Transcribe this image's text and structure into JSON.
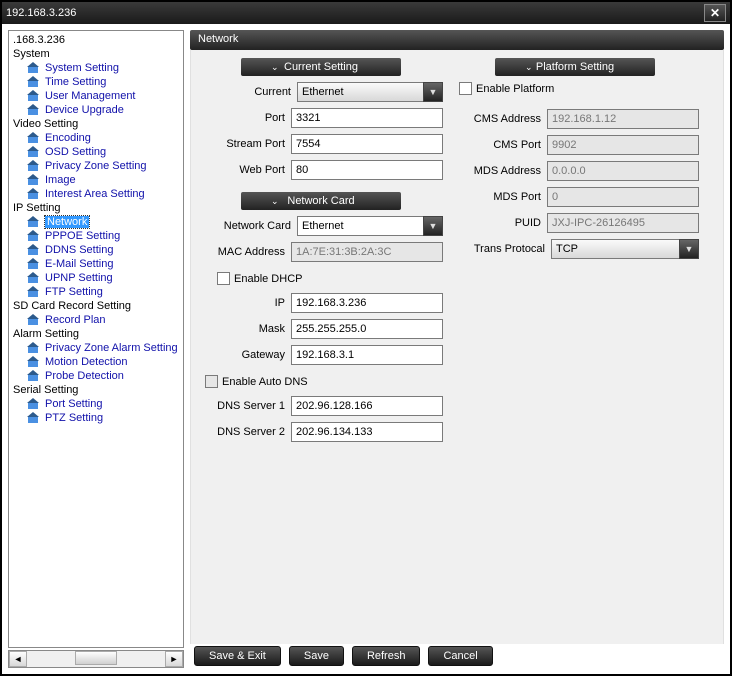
{
  "window": {
    "title": "192.168.3.236"
  },
  "sidebar": {
    "root": ".168.3.236",
    "groups": [
      {
        "label": "System",
        "items": [
          "System Setting",
          "Time Setting",
          "User Management",
          "Device Upgrade"
        ]
      },
      {
        "label": "Video Setting",
        "items": [
          "Encoding",
          "OSD Setting",
          "Privacy Zone Setting",
          "Image",
          "Interest Area Setting"
        ]
      },
      {
        "label": "IP Setting",
        "items": [
          "Network",
          "PPPOE Setting",
          "DDNS Setting",
          "E-Mail Setting",
          "UPNP Setting",
          "FTP Setting"
        ]
      },
      {
        "label": "SD Card Record Setting",
        "items": [
          "Record Plan"
        ]
      },
      {
        "label": "Alarm Setting",
        "items": [
          "Privacy Zone Alarm Setting",
          "Motion Detection",
          "Probe Detection"
        ]
      },
      {
        "label": "Serial Setting",
        "items": [
          "Port Setting",
          "PTZ Setting"
        ]
      }
    ],
    "selected": "Network"
  },
  "main": {
    "title": "Network",
    "sections": {
      "current": {
        "header": "Current Setting",
        "current_label": "Current",
        "current_value": "Ethernet",
        "port_label": "Port",
        "port_value": "3321",
        "stream_port_label": "Stream Port",
        "stream_port_value": "7554",
        "web_port_label": "Web Port",
        "web_port_value": "80"
      },
      "card": {
        "header": "Network Card",
        "card_label": "Network Card",
        "card_value": "Ethernet",
        "mac_label": "MAC Address",
        "mac_value": "1A:7E:31:3B:2A:3C",
        "dhcp_label": "Enable DHCP",
        "ip_label": "IP",
        "ip_value": "192.168.3.236",
        "mask_label": "Mask",
        "mask_value": "255.255.255.0",
        "gateway_label": "Gateway",
        "gateway_value": "192.168.3.1",
        "autodns_label": "Enable Auto DNS",
        "dns1_label": "DNS Server 1",
        "dns1_value": "202.96.128.166",
        "dns2_label": "DNS Server 2",
        "dns2_value": "202.96.134.133"
      },
      "platform": {
        "header": "Platform Setting",
        "enable_label": "Enable Platform",
        "cms_addr_label": "CMS Address",
        "cms_addr_value": "192.168.1.12",
        "cms_port_label": "CMS Port",
        "cms_port_value": "9902",
        "mds_addr_label": "MDS Address",
        "mds_addr_value": "0.0.0.0",
        "mds_port_label": "MDS Port",
        "mds_port_value": "0",
        "puid_label": "PUID",
        "puid_value": "JXJ-IPC-26126495",
        "trans_label": "Trans Protocal",
        "trans_value": "TCP"
      }
    },
    "buttons": {
      "save_exit": "Save & Exit",
      "save": "Save",
      "refresh": "Refresh",
      "cancel": "Cancel"
    }
  }
}
